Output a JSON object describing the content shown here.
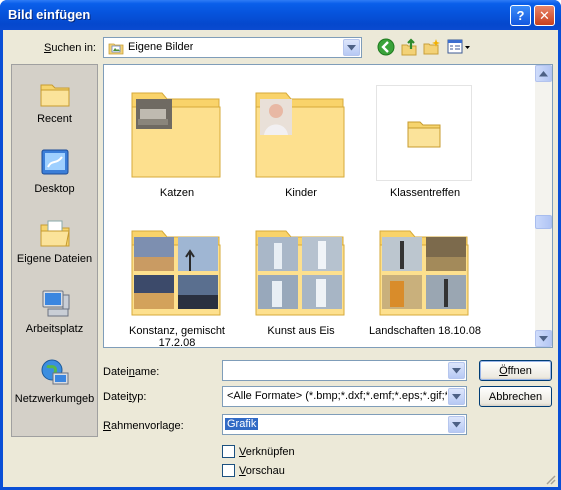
{
  "window": {
    "title": "Bild einfügen"
  },
  "titlebar": {
    "help_label": "?",
    "close_label": "✕"
  },
  "lookin": {
    "label_pre": "",
    "label_u": "S",
    "label_post": "uchen in:",
    "value": "Eigene Bilder"
  },
  "toolbar": {
    "icons": [
      "back-icon",
      "up-folder-icon",
      "new-folder-icon",
      "view-menu-icon"
    ]
  },
  "places": [
    {
      "id": "recent",
      "label": "Recent",
      "icon": "recent-folder-icon"
    },
    {
      "id": "desktop",
      "label": "Desktop",
      "icon": "desktop-icon"
    },
    {
      "id": "documents",
      "label": "Eigene Dateien",
      "icon": "documents-folder-icon"
    },
    {
      "id": "computer",
      "label": "Arbeitsplatz",
      "icon": "computer-icon"
    },
    {
      "id": "network",
      "label": "Netzwerkumgeb",
      "icon": "network-icon"
    }
  ],
  "files": [
    {
      "name": "Katzen",
      "type": "folder-preview"
    },
    {
      "name": "Kinder",
      "type": "folder-preview"
    },
    {
      "name": "Klassentreffen",
      "type": "folder"
    },
    {
      "name": "Konstanz, gemischt 17.2.08",
      "type": "folder-preview"
    },
    {
      "name": "Kunst aus Eis",
      "type": "folder-preview"
    },
    {
      "name": "Landschaften 18.10.08",
      "type": "folder-preview"
    }
  ],
  "filename": {
    "label_pre": "Datei",
    "label_u": "n",
    "label_post": "ame:",
    "value": ""
  },
  "filetype": {
    "label_pre": "Datei",
    "label_u": "t",
    "label_post": "yp:",
    "value": "<Alle Formate> (*.bmp;*.dxf;*.emf;*.eps;*.gif;*.jpg"
  },
  "frame": {
    "label_pre": "",
    "label_u": "R",
    "label_post": "ahmenvorlage:",
    "value": "Grafik"
  },
  "buttons": {
    "open_u": "Ö",
    "open_rest": "ffnen",
    "cancel": "Abbrechen"
  },
  "options": [
    {
      "label_u": "V",
      "label_rest": "erknüpfen",
      "checked": false
    },
    {
      "label_u": "V",
      "label_rest": "orschau",
      "checked": false
    }
  ]
}
